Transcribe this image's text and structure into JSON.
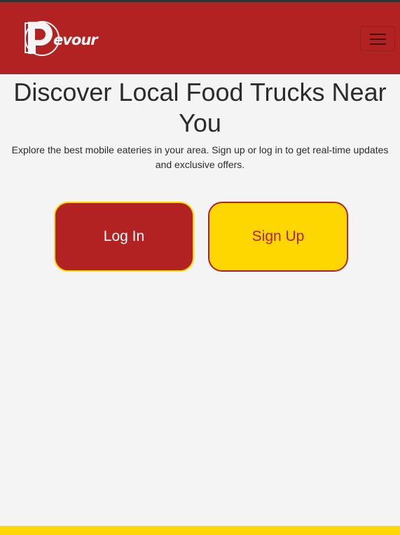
{
  "colors": {
    "primary": "#b22222",
    "accent": "#ffd700",
    "background": "#f4f4f4",
    "text": "#2b2b2b"
  },
  "navbar": {
    "brand_text": "Devour",
    "menu_icon": "hamburger-icon"
  },
  "hero": {
    "title": "Discover Local Food Trucks Near You",
    "subtitle": "Explore the best mobile eateries in your area. Sign up or log in to get real-time updates and exclusive offers."
  },
  "actions": {
    "login_label": "Log In",
    "signup_label": "Sign Up"
  }
}
